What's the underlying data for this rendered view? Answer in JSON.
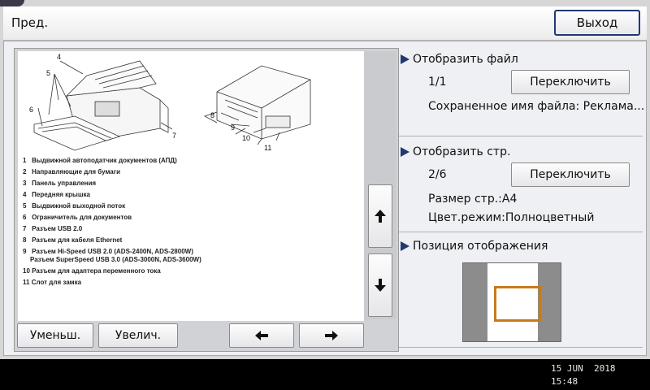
{
  "header": {
    "title": "Пред.",
    "exit_label": "Выход"
  },
  "preview": {
    "diagram_callouts_left": [
      "4",
      "5",
      "6",
      "7"
    ],
    "diagram_callouts_right": [
      "8",
      "9",
      "10",
      "11"
    ],
    "legend": [
      {
        "num": "1",
        "text": "Выдвижной автоподатчик документов (АПД)"
      },
      {
        "num": "2",
        "text": "Направляющие для бумаги"
      },
      {
        "num": "3",
        "text": "Панель управления"
      },
      {
        "num": "4",
        "text": "Передняя крышка"
      },
      {
        "num": "5",
        "text": "Выдвижной выходной поток"
      },
      {
        "num": "6",
        "text": "Ограничитель для документов"
      },
      {
        "num": "7",
        "text": "Разъем USB 2.0"
      },
      {
        "num": "8",
        "text": "Разъем для кабеля Ethernet"
      },
      {
        "num": "9",
        "text": "Разъем Hi-Speed USB 2.0 (ADS-2400N, ADS-2800W)",
        "text2": "Разъем SuperSpeed USB 3.0 (ADS-3000N, ADS-3600W)"
      },
      {
        "num": "10",
        "text": "Разъем для адаптера переменного тока"
      },
      {
        "num": "11",
        "text": "Слот для замка"
      }
    ],
    "zoom_out_label": "Уменьш.",
    "zoom_in_label": "Увелич.",
    "prev_icon": "arrow-left-icon",
    "next_icon": "arrow-right-icon",
    "scroll_up_icon": "arrow-up-icon",
    "scroll_down_icon": "arrow-down-icon"
  },
  "side": {
    "file_section": {
      "heading": "Отобразить файл",
      "counter": "1/1",
      "switch_label": "Переключить",
      "saved_name": "Сохраненное имя файла: Реклама..."
    },
    "page_section": {
      "heading": "Отобразить стр.",
      "counter": "2/6",
      "switch_label": "Переключить",
      "page_size": "Размер стр.:A4",
      "color_mode": "Цвет.режим:Полноцветный"
    },
    "position_section": {
      "heading": "Позиция отображения"
    }
  },
  "status": {
    "date": "15 JUN  2018",
    "time": "15:48"
  },
  "colors": {
    "accent": "#1f3a72",
    "frame": "#c87a1a"
  }
}
